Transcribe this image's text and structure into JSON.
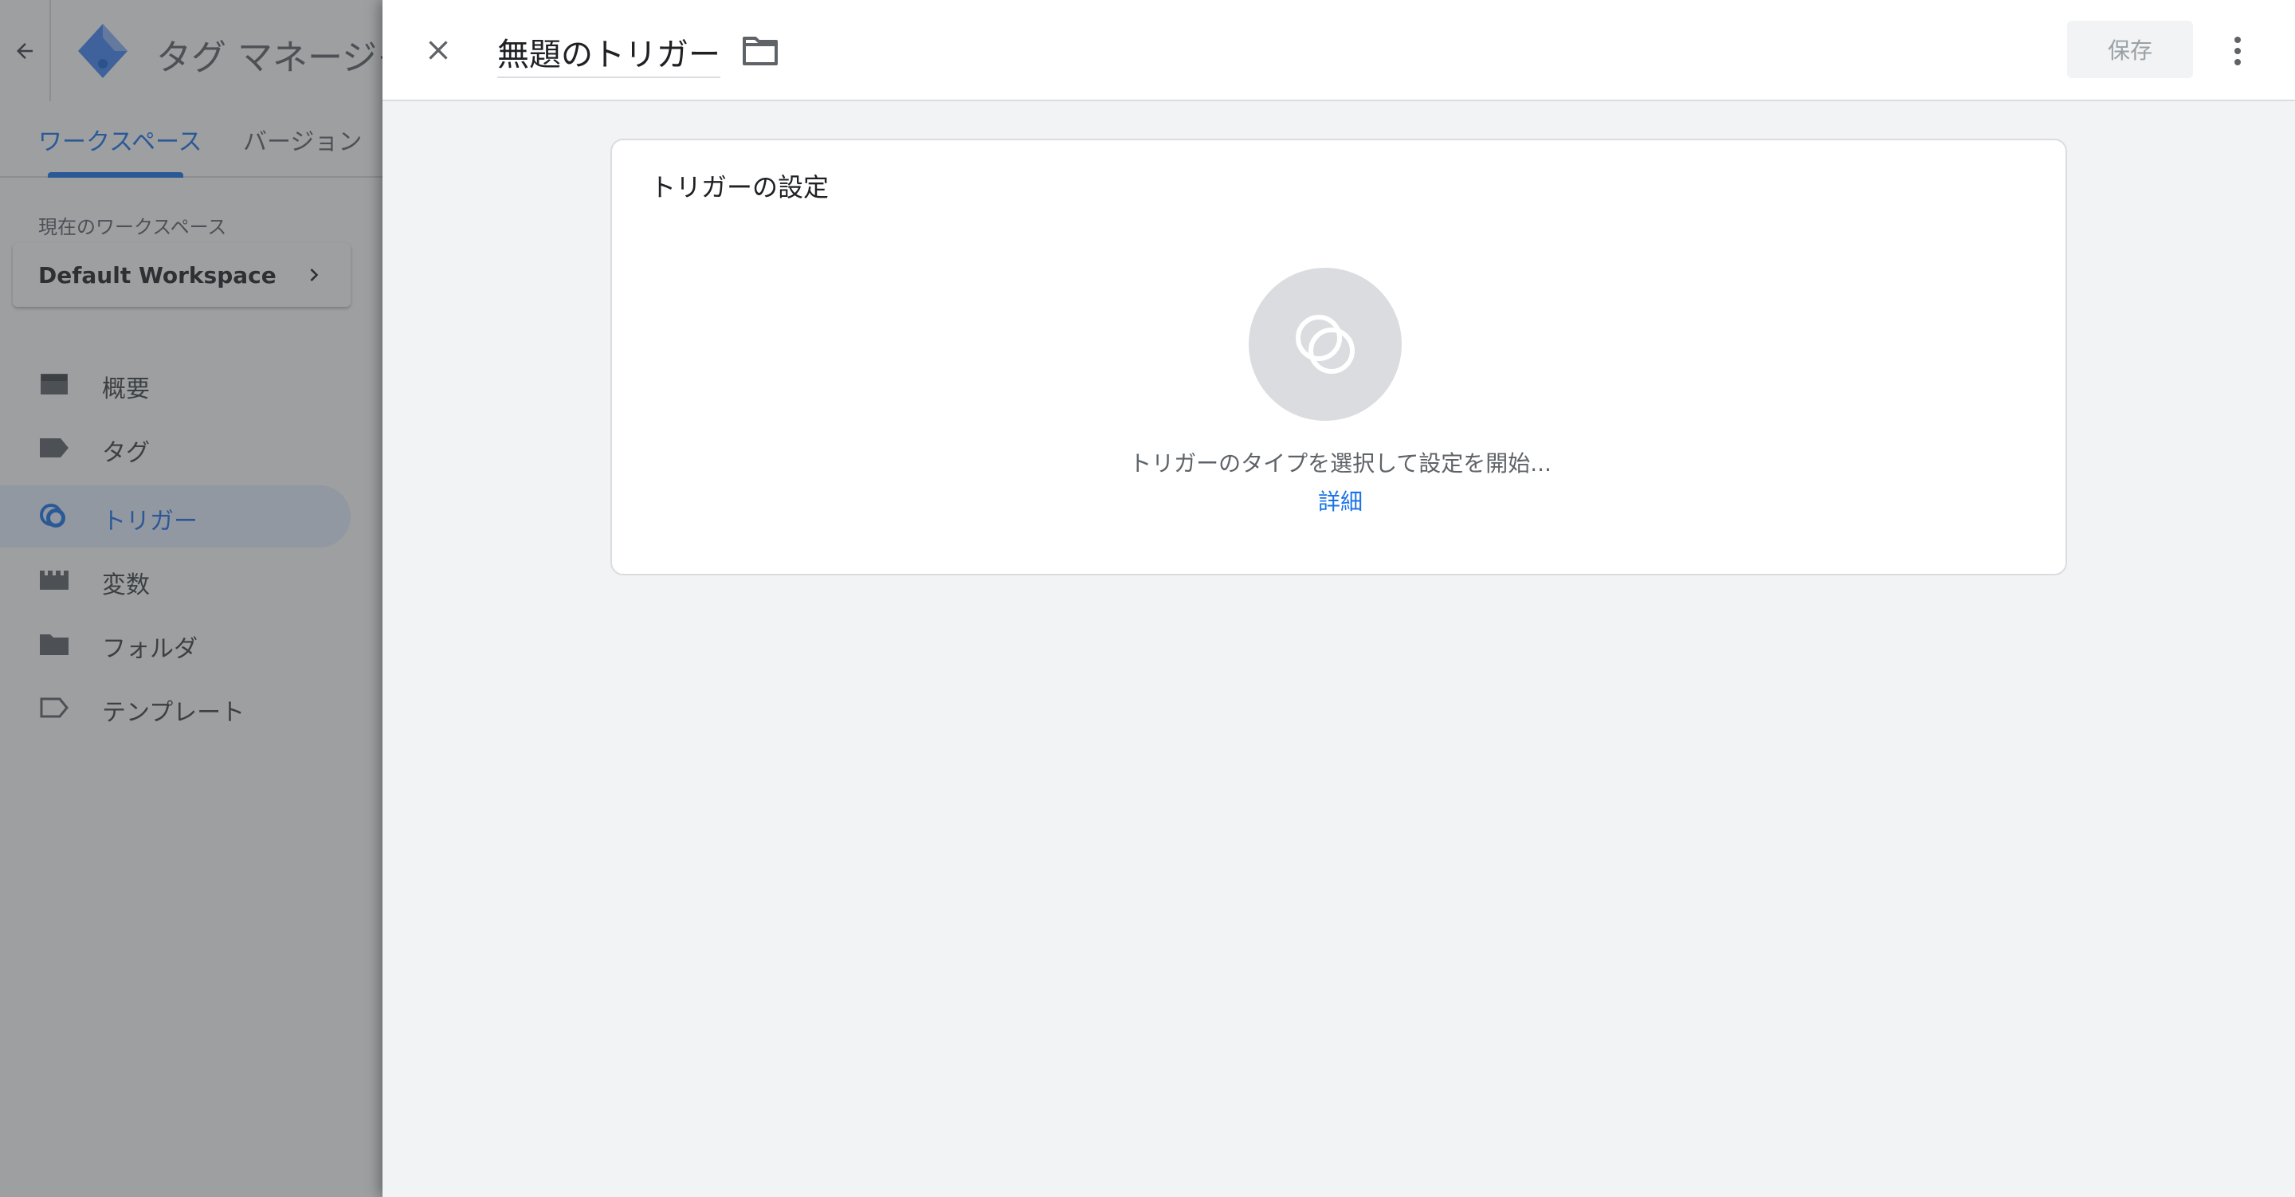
{
  "app": {
    "title": "タグ マネージャー",
    "tabs": [
      {
        "label": "ワークスペース",
        "active": true
      },
      {
        "label": "バージョン",
        "active": false
      }
    ],
    "workspace": {
      "label": "現在のワークスペース",
      "name": "Default Workspace"
    },
    "nav": [
      {
        "label": "概要",
        "icon": "overview-icon"
      },
      {
        "label": "タグ",
        "icon": "tag-icon"
      },
      {
        "label": "トリガー",
        "icon": "trigger-icon",
        "active": true
      },
      {
        "label": "変数",
        "icon": "variable-icon"
      },
      {
        "label": "フォルダ",
        "icon": "folder-icon"
      },
      {
        "label": "テンプレート",
        "icon": "template-icon"
      }
    ]
  },
  "panel": {
    "title": "無題のトリガー",
    "save_label": "保存",
    "card": {
      "title": "トリガーの設定",
      "placeholder": "トリガーのタイプを選択して設定を開始...",
      "learn_more": "詳細"
    }
  },
  "colors": {
    "accent": "#1a73e8",
    "panel_bg": "#f1f3f4",
    "icon_grey": "#5f6368"
  }
}
